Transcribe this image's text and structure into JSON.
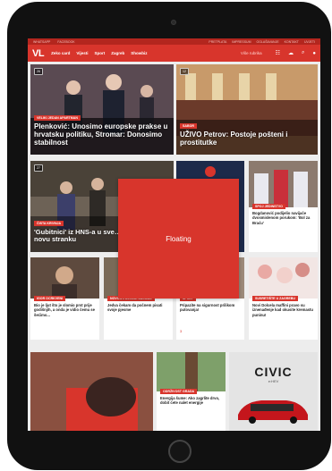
{
  "topstrip": {
    "left": [
      "WHATSAPP",
      "FACEBOOK"
    ],
    "right": [
      "PRETPLATA",
      "IMPRESSUM",
      "OGLAŠAVANJE",
      "KONTAKT",
      "UVJETI"
    ]
  },
  "nav": {
    "logo": "VL",
    "links": [
      "Zeko card",
      "Vijesti",
      "Sport",
      "Zagreb",
      "Showbiz"
    ],
    "more": "Više rubrika",
    "icons": [
      "grid-icon",
      "clock-icon",
      "weather-icon",
      "search-icon",
      "user-icon"
    ]
  },
  "articles": [
    {
      "tag": "VELIKI JEDAN APARTMAN",
      "title": "Plenković: Unosimo europske prakse u hrvatsku politiku, Stromar: Donosimo stabilnost",
      "count": "26"
    },
    {
      "tag": "SABOR",
      "title": "UŽIVO Petrov: Postoje pošteni i prostitutke",
      "count": "12"
    },
    {
      "tag": "ČISTA KRIVNJA",
      "title": "'Gubitnici' iz HNS-a u sve… možda i u novu stranku",
      "count": "27"
    },
    {
      "tag": "SPOJ JEDINSTVO",
      "title": "Bogdanović podijelio navijače dvosmislenom porukom: 'Bol za Braću'"
    },
    {
      "tag": "IGOR OCRKVENI",
      "title": "Bio je ljut što je slomio prst prije godišnjih, a onda je vidio čemu se šećimo..."
    },
    {
      "tag": "NOVOSTI ATELJE JACOBS",
      "title": "Jedva čekam da počnem pisati svoje pjesme"
    },
    {
      "tag": "SPREP",
      "title": "Pripazite na sigurnost prilikom putovanja!",
      "count": "3"
    },
    {
      "tag": "SUSRETIŠTE U ZAGREBU",
      "title": "Novi Dolcela maffini pravo su iznenađenje kad okusite kremastu puninu!"
    },
    {
      "tag": "ODRŽIVOST GRADA",
      "title": "Energija šume: Ako zagrlite drvo, dobit ćete nalet energije"
    }
  ],
  "ad": {
    "brand": "CIVIC",
    "sub": "e:HEV"
  },
  "floating": {
    "label": "Floating"
  },
  "colors": {
    "brand_red": "#d8352c",
    "dark_red": "#b3261e"
  }
}
